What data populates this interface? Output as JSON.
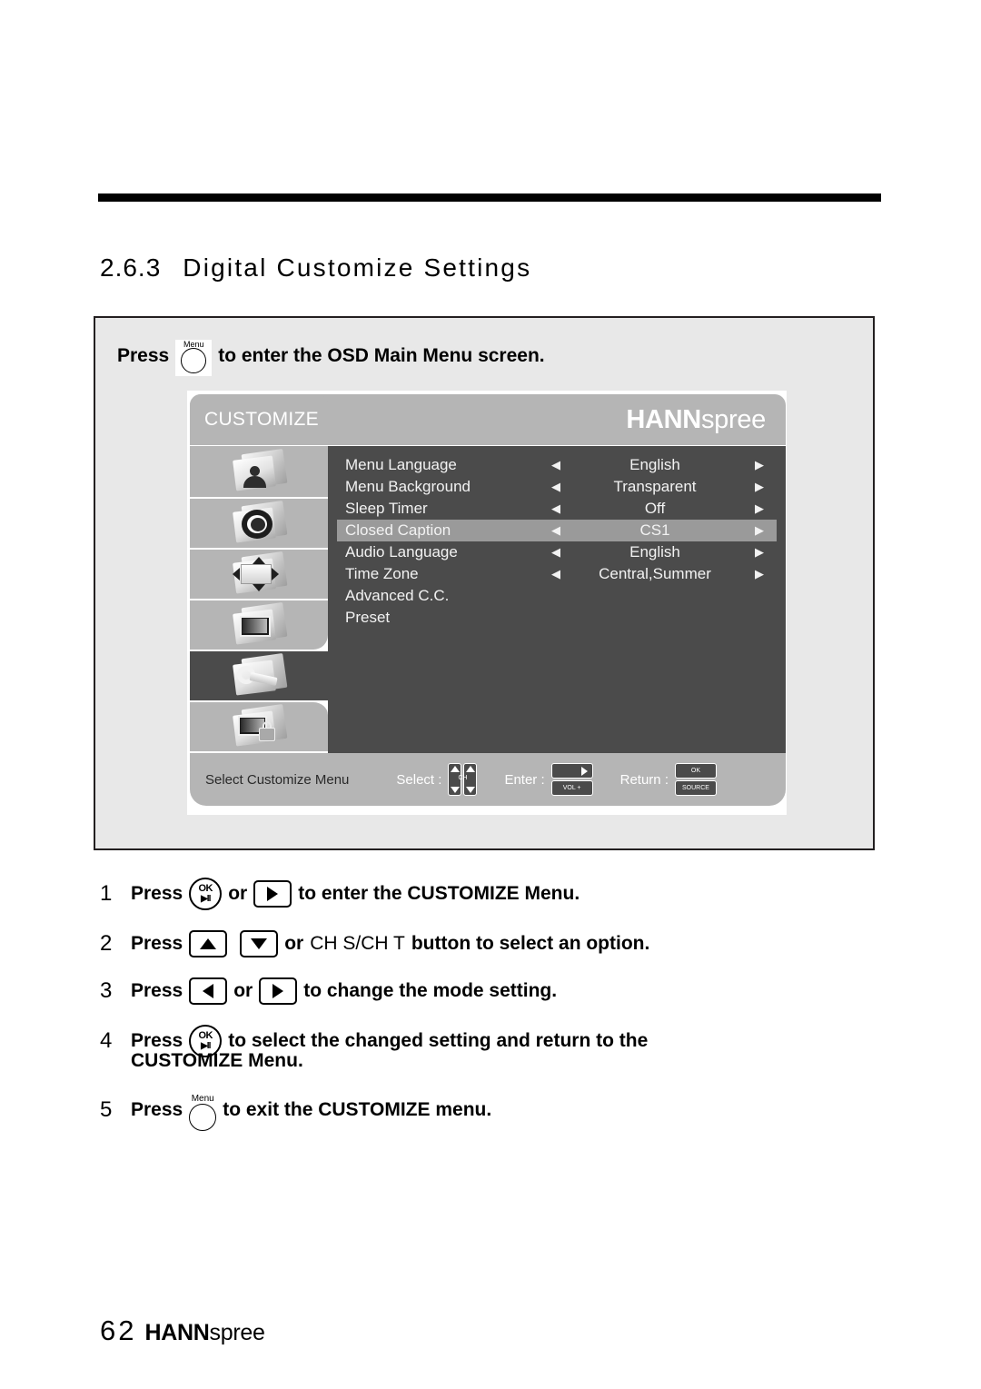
{
  "document": {
    "section_number": "2.6.3",
    "section_title": "Digital Customize Settings",
    "page_number": "62",
    "brand_bold": "HANN",
    "brand_light": "spree"
  },
  "intro": {
    "press_word": "Press",
    "menu_key_label": "Menu",
    "rest": "to enter the OSD Main Menu screen."
  },
  "osd": {
    "tab_label": "CUSTOMIZE",
    "logo_bold": "HANN",
    "logo_light": "spree",
    "sidebar": [
      {
        "name": "picture-icon"
      },
      {
        "name": "audio-lens-icon"
      },
      {
        "name": "position-arrows-icon"
      },
      {
        "name": "screen-icon"
      },
      {
        "name": "customize-wrench-icon"
      },
      {
        "name": "lock-screen-icon"
      }
    ],
    "selected_sidebar_index": 4,
    "rows": [
      {
        "label": "Menu Language",
        "value": "English",
        "left": "◀",
        "right": "▶",
        "highlighted": false
      },
      {
        "label": "Menu Background",
        "value": "Transparent",
        "left": "◀",
        "right": "▶",
        "highlighted": false
      },
      {
        "label": "Sleep Timer",
        "value": "Off",
        "left": "◀",
        "right": "▶",
        "highlighted": false
      },
      {
        "label": "Closed Caption",
        "value": "CS1",
        "left": "◀",
        "right": "▶",
        "highlighted": true
      },
      {
        "label": "Audio Language",
        "value": "English",
        "left": "◀",
        "right": "▶",
        "highlighted": false
      },
      {
        "label": "Time Zone",
        "value": "Central,Summer",
        "left": "◀",
        "right": "▶",
        "highlighted": false
      },
      {
        "label": "Advanced C.C.",
        "value": "",
        "left": "",
        "right": "",
        "highlighted": false
      },
      {
        "label": "Preset",
        "value": "",
        "left": "",
        "right": "",
        "highlighted": false
      }
    ],
    "footer": {
      "title": "Select Customize Menu",
      "select_label": "Select :",
      "select_key_label": "CH",
      "enter_label": "Enter :",
      "enter_key_label": "VOL +",
      "return_label": "Return :",
      "return_key_top": "OK",
      "return_key_bottom": "SOURCE"
    },
    "colors": {
      "header_gray": "#b5b5b5",
      "content_dark": "#4b4b4b",
      "highlight_gray": "#9a9a9a",
      "panel_gray": "#e8e8e8"
    }
  },
  "steps": [
    {
      "number": "1",
      "press": "Press",
      "keys": [
        "ok-play-pause",
        "right-arrow"
      ],
      "joiner": "or",
      "tail": "to enter the CUSTOMIZE Menu."
    },
    {
      "number": "2",
      "press": "Press",
      "keys": [
        "up-arrow",
        "down-arrow"
      ],
      "joiner": "or",
      "mid_plain": "CH S/CH T",
      "tail": "button to select an option."
    },
    {
      "number": "3",
      "press": "Press",
      "keys": [
        "left-arrow",
        "right-arrow"
      ],
      "joiner": "or",
      "tail": "to change the mode setting."
    },
    {
      "number": "4",
      "press": "Press",
      "keys": [
        "ok-play-pause"
      ],
      "tail": "to select the changed setting and return to the",
      "continuation": "CUSTOMIZE Menu."
    },
    {
      "number": "5",
      "press": "Press",
      "keys": [
        "menu-round"
      ],
      "menu_key_label": "Menu",
      "tail": "to exit the CUSTOMIZE menu."
    }
  ],
  "keys": {
    "ok_top": "OK",
    "ok_bottom": "▶II"
  }
}
